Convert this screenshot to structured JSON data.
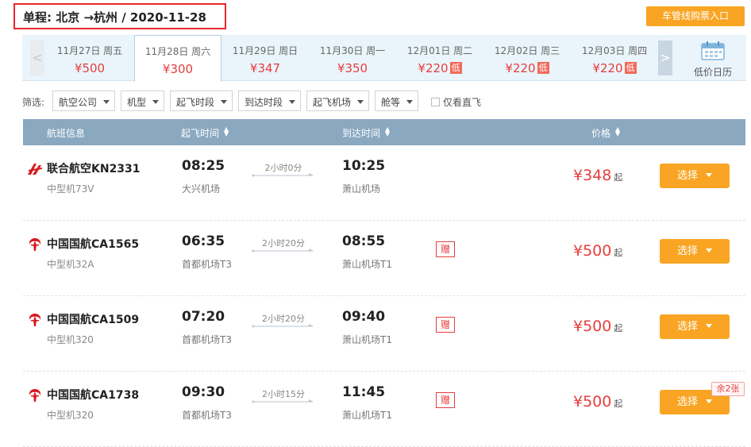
{
  "header": {
    "trip_title": "单程: 北京 →杭州 / 2020-11-28",
    "entry_button": "车管线购票入口"
  },
  "date_strip": {
    "prev_glyph": "<",
    "next_glyph": ">",
    "dates": [
      {
        "label": "11月27日 周五",
        "price": "¥500",
        "low": ""
      },
      {
        "label": "11月28日 周六",
        "price": "¥300",
        "low": ""
      },
      {
        "label": "11月29日 周日",
        "price": "¥347",
        "low": ""
      },
      {
        "label": "11月30日 周一",
        "price": "¥350",
        "low": ""
      },
      {
        "label": "12月01日 周二",
        "price": "¥220",
        "low": "低"
      },
      {
        "label": "12月02日 周三",
        "price": "¥220",
        "low": "低"
      },
      {
        "label": "12月03日 周四",
        "price": "¥220",
        "low": "低"
      }
    ],
    "active_index": 1,
    "calendar_label": "低价日历"
  },
  "filters": {
    "label": "筛选:",
    "dropdowns": [
      "航空公司",
      "机型",
      "起飞时段",
      "到达时段",
      "起飞机场",
      "舱等"
    ],
    "direct_only": "仅看直飞"
  },
  "table_header": {
    "flight": "航班信息",
    "depart": "起飞时间",
    "arrive": "到达时间",
    "price": "价格"
  },
  "flights": [
    {
      "name": "联合航空KN2331",
      "plane": "中型机73V",
      "dep_time": "08:25",
      "dep_airport": "大兴机场",
      "duration": "2小时0分",
      "arr_time": "10:25",
      "arr_airport": "萧山机场",
      "gift": "",
      "price": "¥348",
      "price_suffix": "起",
      "button": "选择",
      "remain": "",
      "logo": "china-united-logo-icon"
    },
    {
      "name": "中国国航CA1565",
      "plane": "中型机32A",
      "dep_time": "06:35",
      "dep_airport": "首都机场T3",
      "duration": "2小时20分",
      "arr_time": "08:55",
      "arr_airport": "萧山机场T1",
      "gift": "赠",
      "price": "¥500",
      "price_suffix": "起",
      "button": "选择",
      "remain": "",
      "logo": "air-china-logo-icon"
    },
    {
      "name": "中国国航CA1509",
      "plane": "中型机320",
      "dep_time": "07:20",
      "dep_airport": "首都机场T3",
      "duration": "2小时20分",
      "arr_time": "09:40",
      "arr_airport": "萧山机场T1",
      "gift": "赠",
      "price": "¥500",
      "price_suffix": "起",
      "button": "选择",
      "remain": "",
      "logo": "air-china-logo-icon"
    },
    {
      "name": "中国国航CA1738",
      "plane": "中型机320",
      "dep_time": "09:30",
      "dep_airport": "首都机场T3",
      "duration": "2小时15分",
      "arr_time": "11:45",
      "arr_airport": "萧山机场T1",
      "gift": "赠",
      "price": "¥500",
      "price_suffix": "起",
      "button": "选择",
      "remain": "余2张",
      "logo": "air-china-logo-icon"
    }
  ],
  "colors": {
    "accent_orange": "#f9a523",
    "price_red": "#e53e3e",
    "header_blue": "#8aa8c0",
    "strip_bg": "#eaf4fb"
  }
}
